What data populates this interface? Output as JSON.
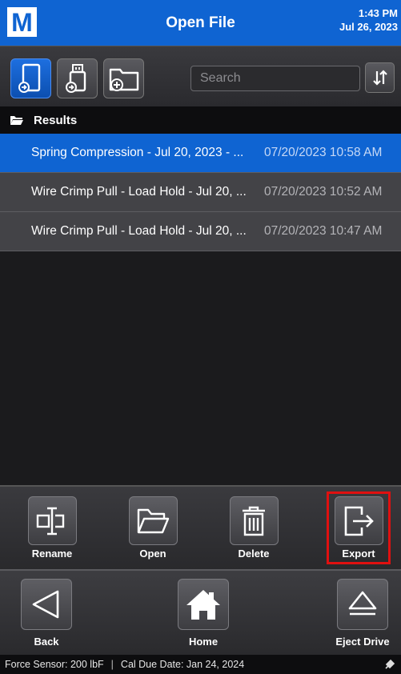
{
  "header": {
    "logo": "M",
    "title": "Open File",
    "time": "1:43 PM",
    "date": "Jul 26, 2023"
  },
  "toolbar": {
    "buttons": [
      {
        "name": "internal-storage",
        "icon": "phone-file-icon",
        "active": true
      },
      {
        "name": "usb-drive",
        "icon": "usb-file-icon",
        "active": false
      },
      {
        "name": "new-folder",
        "icon": "folder-plus-icon",
        "active": false
      }
    ],
    "search_placeholder": "Search",
    "sort_icon": "sort-icon"
  },
  "results": {
    "label": "Results",
    "rows": [
      {
        "name": "Spring Compression - Jul 20, 2023 - ...",
        "date": "07/20/2023 10:58 AM",
        "selected": true
      },
      {
        "name": "Wire Crimp Pull - Load Hold - Jul 20, ...",
        "date": "07/20/2023 10:52 AM",
        "selected": false
      },
      {
        "name": "Wire Crimp Pull - Load Hold - Jul 20, ...",
        "date": "07/20/2023 10:47 AM",
        "selected": false
      }
    ]
  },
  "actions": {
    "rename": "Rename",
    "open": "Open",
    "delete": "Delete",
    "export": "Export"
  },
  "nav": {
    "back": "Back",
    "home": "Home",
    "eject": "Eject Drive"
  },
  "status": {
    "sensor": "Force Sensor: 200 lbF",
    "separator": "|",
    "cal": "Cal Due Date: Jan 24, 2024"
  },
  "colors": {
    "accent": "#0f64d2",
    "highlight": "#e01010"
  }
}
